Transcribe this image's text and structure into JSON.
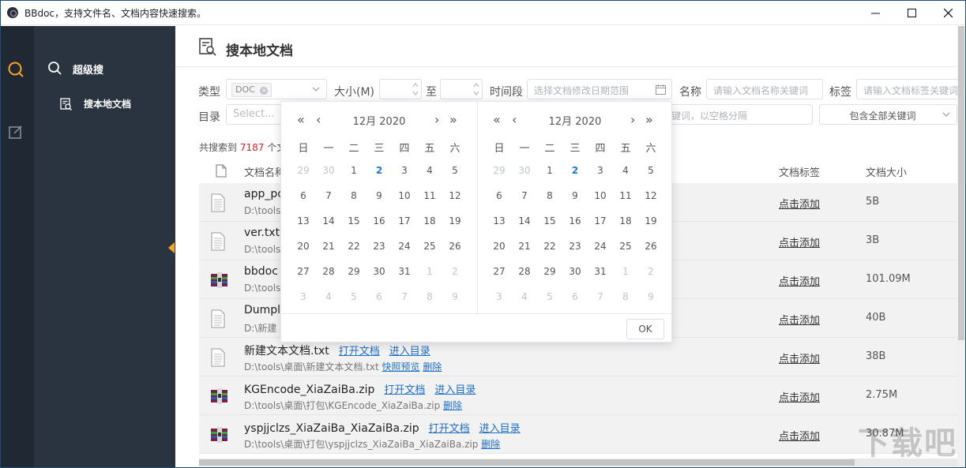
{
  "window": {
    "title": "BBdoc，支持文件名、文档内容快速搜索。"
  },
  "sidebar": {
    "items": [
      {
        "label": "超级搜"
      },
      {
        "label": "搜本地文档"
      }
    ]
  },
  "page": {
    "title": "搜本地文档"
  },
  "filters": {
    "type_label": "类型",
    "type_tag": "DOC",
    "size_label": "大小(M)",
    "size_to": "至",
    "period_label": "时间段",
    "period_placeholder": "选择文档修改日期范围",
    "name_label": "名称",
    "name_placeholder": "请输入文档名称关键词",
    "tag_label": "标签",
    "tag_placeholder": "请输入文档标签关键词",
    "dir_label": "目录",
    "dir_placeholder": "Select...",
    "keywords_placeholder_fragment": "键词，以空格分隔",
    "match_mode": "包含全部关键词"
  },
  "summary": {
    "prefix": "共搜索到",
    "count": "7187",
    "suffix_fragment": "个文"
  },
  "columns": {
    "name_fragment": "文档名称",
    "tag": "文档标签",
    "size": "文档大小"
  },
  "rows": [
    {
      "kind": "txt",
      "name": "app_pc",
      "path": "D:\\tools",
      "tag": "点击添加",
      "size": "5B"
    },
    {
      "kind": "txt",
      "name": "ver.txt",
      "path": "D:\\tools",
      "tag": "点击添加",
      "size": "3B"
    },
    {
      "kind": "zip",
      "name": "bbdoc",
      "path": "D:\\tools",
      "tag": "点击添加",
      "size": "101.09M"
    },
    {
      "kind": "txt",
      "name": "Dumpl",
      "path": "D:\\新建",
      "tag": "点击添加",
      "size": "40B"
    },
    {
      "kind": "txt",
      "name": "新建文本文档.txt",
      "open": "打开文档",
      "enter": "进入目录",
      "path": "D:\\tools\\桌面\\新建文本文档.txt",
      "preview": "快照预览",
      "delete": "删除",
      "tag": "点击添加",
      "size": "38B"
    },
    {
      "kind": "zip",
      "name": "KGEncode_XiaZaiBa.zip",
      "open": "打开文档",
      "enter": "进入目录",
      "path": "D:\\tools\\桌面\\打包\\KGEncode_XiaZaiBa.zip",
      "delete": "删除",
      "tag": "点击添加",
      "size": "2.75M"
    },
    {
      "kind": "zip",
      "name": "yspjjclzs_XiaZaiBa_XiaZaiBa.zip",
      "open": "打开文档",
      "enter": "进入目录",
      "path": "D:\\tools\\桌面\\打包\\yspjjclzs_XiaZaiBa_XiaZaiBa.zip",
      "delete": "删除",
      "tag": "点击添加",
      "size": "30.87M"
    }
  ],
  "datepicker": {
    "nav": {
      "prev_year": "«",
      "prev_month": "‹",
      "next_month": "›",
      "next_year": "»"
    },
    "weekdays": [
      "日",
      "一",
      "二",
      "三",
      "四",
      "五",
      "六"
    ],
    "calendars": [
      {
        "title": "12月 2020",
        "today": "2",
        "days": [
          "29",
          "30",
          "1",
          "2",
          "3",
          "4",
          "5",
          "6",
          "7",
          "8",
          "9",
          "10",
          "11",
          "12",
          "13",
          "14",
          "15",
          "16",
          "17",
          "18",
          "19",
          "20",
          "21",
          "22",
          "23",
          "24",
          "25",
          "26",
          "27",
          "28",
          "29",
          "30",
          "31",
          "1",
          "2",
          "3",
          "4",
          "5",
          "6",
          "7",
          "8",
          "9"
        ],
        "current_range": [
          2,
          32
        ]
      },
      {
        "title": "12月 2020",
        "today": "2",
        "days": [
          "29",
          "30",
          "1",
          "2",
          "3",
          "4",
          "5",
          "6",
          "7",
          "8",
          "9",
          "10",
          "11",
          "12",
          "13",
          "14",
          "15",
          "16",
          "17",
          "18",
          "19",
          "20",
          "21",
          "22",
          "23",
          "24",
          "25",
          "26",
          "27",
          "28",
          "29",
          "30",
          "31",
          "1",
          "2",
          "3",
          "4",
          "5",
          "6",
          "7",
          "8",
          "9"
        ],
        "current_range": [
          2,
          32
        ]
      }
    ],
    "ok": "OK"
  },
  "colors": {
    "accent": "#f5a623",
    "link": "#1f6fc4",
    "count": "#e02020",
    "sidebar": "#2a3440",
    "iconbar": "#1f2833"
  }
}
